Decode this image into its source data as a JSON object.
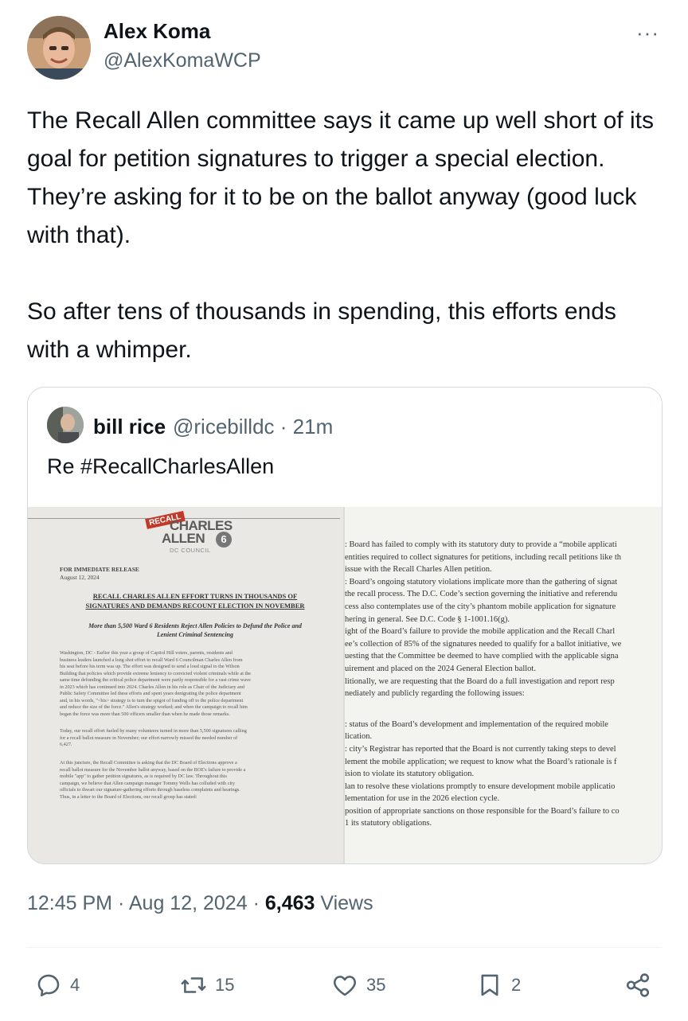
{
  "author": {
    "name": "Alex Koma",
    "handle": "@AlexKomaWCP",
    "avatar_icon": "user-avatar"
  },
  "more_icon": "more-options-icon",
  "more_label": "···",
  "tweet": {
    "p1": "The Recall Allen committee says it came up well short of its goal for petition signatures to trigger a special election. They’re asking for it to be on the ballot anyway (good luck with that).",
    "p2": "So after tens of thousands in spending, this efforts ends with a whimper."
  },
  "quote": {
    "name": "bill rice",
    "handle_time": "@ricebilldc · 21m",
    "text": "Re #RecallCharlesAllen",
    "doc1": {
      "badge": "RECALL",
      "logo_line1": "CHARLES",
      "logo_line2": "ALLEN",
      "logo_ward": "6",
      "logo_line3": "DC COUNCIL",
      "release": "FOR IMMEDIATE RELEASE",
      "date": "August 12, 2024",
      "headline1": "RECALL CHARLES ALLEN EFFORT TURNS IN THOUSANDS OF",
      "headline2": "SIGNATURES AND DEMANDS RECOUNT ELECTION IN NOVEMBER",
      "sub1": "More than 5,500 Ward 6 Residents Reject Allen Policies to Defund the Police and",
      "sub2": "Lenient Criminal Sentencing",
      "para1": "Washington, DC - Earlier this year a group of Capitol Hill voters, parents, residents and\nbusiness leaders launched a long shot effort to recall Ward 6 Councilman Charles Allen from\nhis seat before his term was up. The effort was designed to send a loud signal to the Wilson\nBuilding that policies which provide extreme leniency to convicted violent criminals while at the\nsame time defunding the critical police department were partly responsible for a vast crime wave\nin 2023 which has continued into 2024. Charles Allen in his role as Chair of the Judiciary and\nPublic Safety Committee led these efforts and spent years denigrating the police department\nand, in his words, \"<his> strategy is to turn the spigot of funding off to the police department\nand reduce the size of the force.\" Allen's strategy worked; and when the campaign to recall him\nbegan the force was more than 500 officers smaller than when he made those remarks.",
      "para2": "Today, our recall effort fueled by many volunteers turned in more than 5,500 signatures calling\nfor a recall ballot measure in November; our effort narrowly missed the needed number of\n6,427.",
      "para3": "At this juncture, the Recall Committee is asking that the DC Board of Elections approve a\nrecall ballot measure for the November ballot anyway, based on the BOE's failure to provide a\nmobile \"app\" to gather petition signatures, as is required by DC law. Throughout this\ncampaign, we believe that Allen campaign manager Tommy Wells has colluded with city\nofficials to thwart our signature-gathering efforts through baseless complaints and hearings.\nThus, in a letter to the Board of Elections, our recall group has stated:"
    },
    "doc2": {
      "lines": [
        ": Board has failed to comply with its statutory duty to provide a “mobile applicati",
        "entities required to collect signatures for petitions, including recall petitions like th",
        "issue with the Recall Charles Allen petition.",
        ": Board’s ongoing statutory violations implicate more than the gathering of signat",
        "the recall process. The D.C. Code’s section governing the initiative and referendu",
        "cess also contemplates use of the city’s phantom mobile application for signature",
        "hering in general. See D.C. Code § 1-1001.16(g).",
        "ight of the Board’s failure to provide the mobile application and the Recall Charl",
        "ee’s collection of 85% of the signatures needed to qualify for a ballot initiative, we",
        "uesting that the Committee be deemed to have complied with the applicable signa",
        "uirement and placed on the 2024 General Election ballot.",
        "litionally, we are requesting that the Board do a full investigation and report resp",
        "nediately and publicly regarding the following issues:",
        "",
        ": status of the Board’s development and implementation of the required mobile",
        "lication.",
        ": city’s Registrar has reported that the Board is not currently taking steps to devel",
        "lement the mobile application; we request to know what the Board’s rationale is f",
        "ision to violate its statutory obligation.",
        "lan to resolve these violations promptly to ensure development mobile applicatio",
        "lementation for use in the 2026 election cycle.",
        "position of appropriate sanctions on those responsible for the Board’s failure to co",
        "1 its statutory obligations."
      ]
    }
  },
  "meta": {
    "time": "12:45 PM",
    "dot1": "·",
    "date": "Aug 12, 2024",
    "dot2": "·",
    "views_count": "6,463",
    "views_label": "Views"
  },
  "actions": {
    "replies": "4",
    "reposts": "15",
    "likes": "35",
    "bookmarks": "2"
  },
  "colors": {
    "text": "#0f1419",
    "secondary": "#536471",
    "border": "#cfd9de"
  }
}
